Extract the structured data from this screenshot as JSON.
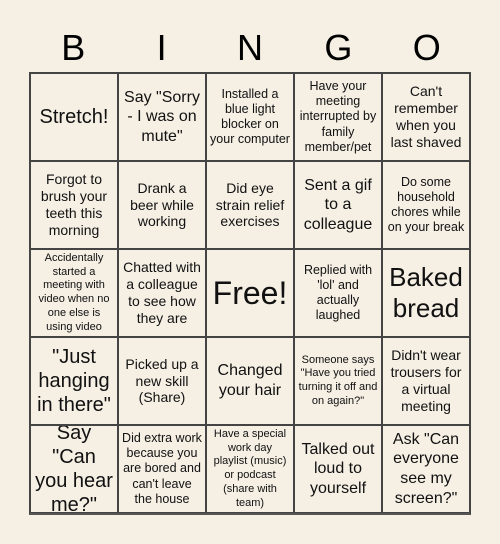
{
  "header": {
    "letters": [
      "B",
      "I",
      "N",
      "G",
      "O"
    ]
  },
  "board": {
    "cells": [
      "Stretch!",
      "Say \"Sorry - I was on mute\"",
      "Installed a blue light blocker on your computer",
      "Have your meeting interrupted by family member/pet",
      "Can't remember when you last shaved",
      "Forgot to brush your teeth this morning",
      "Drank a beer while working",
      "Did eye strain relief exercises",
      "Sent a gif to a colleague",
      "Do some household chores while on your break",
      "Accidentally started a meeting with video when no one else is using video",
      "Chatted with a colleague to see how they are",
      "Free!",
      "Replied with 'lol' and actually laughed",
      "Baked bread",
      "\"Just hanging in there\"",
      "Picked up a new skill (Share)",
      "Changed your hair",
      "Someone says \"Have you tried turning it off and on again?\"",
      "Didn't wear trousers for a virtual meeting",
      "Say \"Can you hear me?\"",
      "Did extra work because you are bored and can't leave the house",
      "Have a special work day playlist (music) or podcast (share with team)",
      "Talked out loud to yourself",
      "Ask \"Can everyone see my screen?\""
    ],
    "free_index": 12
  },
  "colors": {
    "background": "#f5efe4",
    "grid_line": "#444444",
    "text": "#111111"
  }
}
